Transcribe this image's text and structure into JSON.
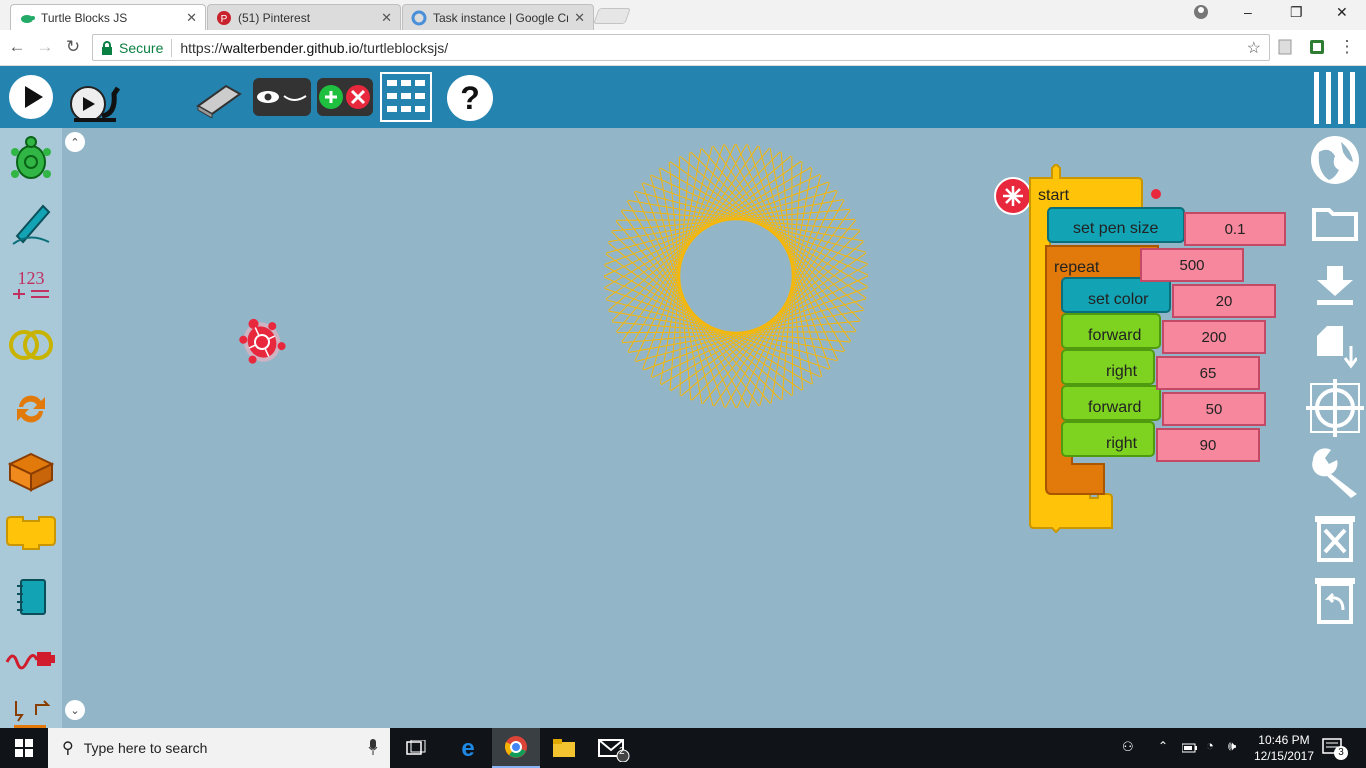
{
  "browser": {
    "tabs": [
      {
        "title": "Turtle Blocks JS",
        "active": true
      },
      {
        "title": "(51) Pinterest",
        "active": false
      },
      {
        "title": "Task instance | Google Cr",
        "active": false
      }
    ],
    "secure_label": "Secure",
    "url_prefix": "https://",
    "url_host": "walterbender.github.io",
    "url_path": "/turtleblocksjs/"
  },
  "header": {
    "buttons": [
      "play-icon",
      "slow-snail-icon",
      "eraser-icon",
      "hide-show-blocks-icon",
      "collapse-expand-icon",
      "grid-icon",
      "help-icon",
      "menu-icon"
    ]
  },
  "palette": {
    "items": [
      "turtle-icon",
      "pen-icon",
      "number-icon",
      "boolean-icon",
      "flow-icon",
      "box-icon",
      "action-icon",
      "media-icon",
      "sensors-icon",
      "extras-icon"
    ],
    "number_label": "123"
  },
  "blocks": {
    "start": "start",
    "set_pen_size": "set pen size",
    "pen_size_value": "0.1",
    "repeat": "repeat",
    "repeat_value": "500",
    "set_color": "set color",
    "color_value": "20",
    "forward1": "forward",
    "forward1_value": "200",
    "right1": "right",
    "right1_value": "65",
    "forward2": "forward",
    "forward2_value": "50",
    "right2": "right",
    "right2_value": "90"
  },
  "colors": {
    "header": "#2584af",
    "canvas": "#92b5c8",
    "palette": "#a9c9d8",
    "drawing": "#f5b70a",
    "start_block": "#ffc40a",
    "repeat_block": "#e2790b",
    "pen_block": "#12a3b4",
    "motion_block": "#7ed321",
    "number_box": "#f6879c"
  },
  "taskbar": {
    "search_placeholder": "Type here to search",
    "time": "10:46 PM",
    "date": "12/15/2017",
    "notifications": "3",
    "mail_badge": "2"
  }
}
